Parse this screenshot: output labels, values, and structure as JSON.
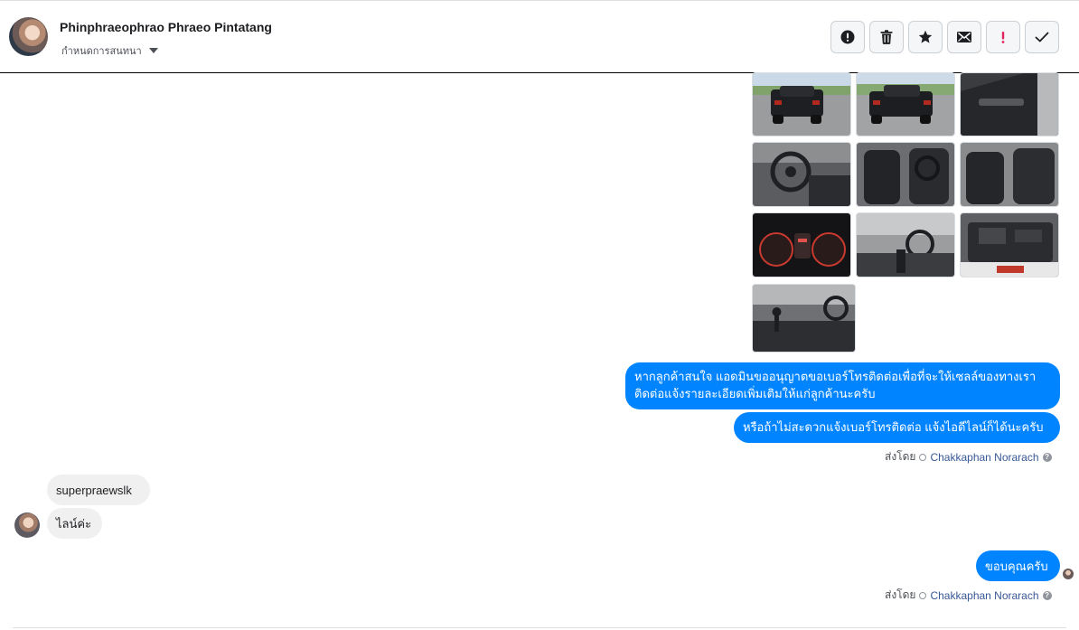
{
  "conversation": {
    "name": "Phinphraeophrao Phraeo Pintatang",
    "assign_label": "กำหนดการสนทนา"
  },
  "toolbar": {
    "icons": [
      "alert-circle-icon",
      "trash-icon",
      "star-icon",
      "envelope-icon",
      "exclamation-icon",
      "checkmark-icon"
    ]
  },
  "photos": [
    {
      "icon": "pickup-truck-rear-photo"
    },
    {
      "icon": "pickup-truck-rear-side-photo"
    },
    {
      "icon": "door-interior-photo"
    },
    {
      "icon": "steering-wheel-photo"
    },
    {
      "icon": "front-seats-photo"
    },
    {
      "icon": "seats-side-view-photo"
    },
    {
      "icon": "instrument-cluster-photo"
    },
    {
      "icon": "dashboard-photo"
    },
    {
      "icon": "engine-bay-photo"
    },
    {
      "icon": "gear-shift-console-photo"
    }
  ],
  "messages": {
    "out1_line1": "หากลูกค้าสนใจ แอดมินขออนุญาตขอเบอร์โทรติดต่อเพื่อที่จะให้เซลล์ของทางเรา",
    "out1_line2": "ติดต่อแจ้งรายละเอียดเพิ่มเติมให้แก่ลูกค้านะครับ",
    "out2": "หรือถ้าไม่สะดวกแจ้งเบอร์โทรติดต่อ แจ้งไอดีไลน์ก็ได้นะครับ",
    "in1": "superpraewslk",
    "in2": "ไลน์ค่ะ",
    "out3": "ขอบคุณครับ"
  },
  "sent_by": {
    "prefix": "ส่งโดย",
    "agent": "Chakkaphan Norarach",
    "help": "?"
  },
  "colors": {
    "outgoing_bubble": "#0084ff",
    "incoming_bubble": "#f1f0f0",
    "agent_link": "#385898",
    "danger": "#e0245e"
  }
}
